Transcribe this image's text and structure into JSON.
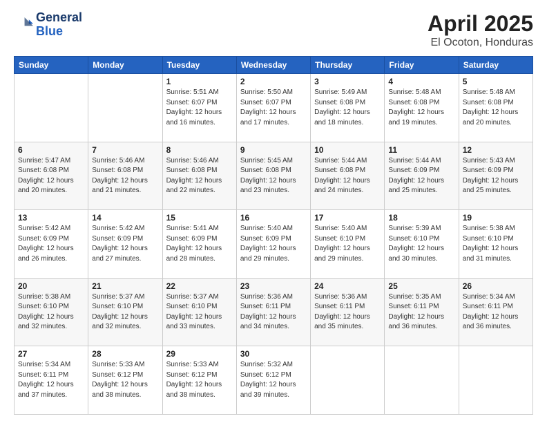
{
  "header": {
    "logo_general": "General",
    "logo_blue": "Blue",
    "title": "April 2025",
    "subtitle": "El Ocoton, Honduras"
  },
  "calendar": {
    "days_of_week": [
      "Sunday",
      "Monday",
      "Tuesday",
      "Wednesday",
      "Thursday",
      "Friday",
      "Saturday"
    ],
    "weeks": [
      [
        {
          "day": "",
          "info": ""
        },
        {
          "day": "",
          "info": ""
        },
        {
          "day": "1",
          "info": "Sunrise: 5:51 AM\nSunset: 6:07 PM\nDaylight: 12 hours and 16 minutes."
        },
        {
          "day": "2",
          "info": "Sunrise: 5:50 AM\nSunset: 6:07 PM\nDaylight: 12 hours and 17 minutes."
        },
        {
          "day": "3",
          "info": "Sunrise: 5:49 AM\nSunset: 6:08 PM\nDaylight: 12 hours and 18 minutes."
        },
        {
          "day": "4",
          "info": "Sunrise: 5:48 AM\nSunset: 6:08 PM\nDaylight: 12 hours and 19 minutes."
        },
        {
          "day": "5",
          "info": "Sunrise: 5:48 AM\nSunset: 6:08 PM\nDaylight: 12 hours and 20 minutes."
        }
      ],
      [
        {
          "day": "6",
          "info": "Sunrise: 5:47 AM\nSunset: 6:08 PM\nDaylight: 12 hours and 20 minutes."
        },
        {
          "day": "7",
          "info": "Sunrise: 5:46 AM\nSunset: 6:08 PM\nDaylight: 12 hours and 21 minutes."
        },
        {
          "day": "8",
          "info": "Sunrise: 5:46 AM\nSunset: 6:08 PM\nDaylight: 12 hours and 22 minutes."
        },
        {
          "day": "9",
          "info": "Sunrise: 5:45 AM\nSunset: 6:08 PM\nDaylight: 12 hours and 23 minutes."
        },
        {
          "day": "10",
          "info": "Sunrise: 5:44 AM\nSunset: 6:08 PM\nDaylight: 12 hours and 24 minutes."
        },
        {
          "day": "11",
          "info": "Sunrise: 5:44 AM\nSunset: 6:09 PM\nDaylight: 12 hours and 25 minutes."
        },
        {
          "day": "12",
          "info": "Sunrise: 5:43 AM\nSunset: 6:09 PM\nDaylight: 12 hours and 25 minutes."
        }
      ],
      [
        {
          "day": "13",
          "info": "Sunrise: 5:42 AM\nSunset: 6:09 PM\nDaylight: 12 hours and 26 minutes."
        },
        {
          "day": "14",
          "info": "Sunrise: 5:42 AM\nSunset: 6:09 PM\nDaylight: 12 hours and 27 minutes."
        },
        {
          "day": "15",
          "info": "Sunrise: 5:41 AM\nSunset: 6:09 PM\nDaylight: 12 hours and 28 minutes."
        },
        {
          "day": "16",
          "info": "Sunrise: 5:40 AM\nSunset: 6:09 PM\nDaylight: 12 hours and 29 minutes."
        },
        {
          "day": "17",
          "info": "Sunrise: 5:40 AM\nSunset: 6:10 PM\nDaylight: 12 hours and 29 minutes."
        },
        {
          "day": "18",
          "info": "Sunrise: 5:39 AM\nSunset: 6:10 PM\nDaylight: 12 hours and 30 minutes."
        },
        {
          "day": "19",
          "info": "Sunrise: 5:38 AM\nSunset: 6:10 PM\nDaylight: 12 hours and 31 minutes."
        }
      ],
      [
        {
          "day": "20",
          "info": "Sunrise: 5:38 AM\nSunset: 6:10 PM\nDaylight: 12 hours and 32 minutes."
        },
        {
          "day": "21",
          "info": "Sunrise: 5:37 AM\nSunset: 6:10 PM\nDaylight: 12 hours and 32 minutes."
        },
        {
          "day": "22",
          "info": "Sunrise: 5:37 AM\nSunset: 6:10 PM\nDaylight: 12 hours and 33 minutes."
        },
        {
          "day": "23",
          "info": "Sunrise: 5:36 AM\nSunset: 6:11 PM\nDaylight: 12 hours and 34 minutes."
        },
        {
          "day": "24",
          "info": "Sunrise: 5:36 AM\nSunset: 6:11 PM\nDaylight: 12 hours and 35 minutes."
        },
        {
          "day": "25",
          "info": "Sunrise: 5:35 AM\nSunset: 6:11 PM\nDaylight: 12 hours and 36 minutes."
        },
        {
          "day": "26",
          "info": "Sunrise: 5:34 AM\nSunset: 6:11 PM\nDaylight: 12 hours and 36 minutes."
        }
      ],
      [
        {
          "day": "27",
          "info": "Sunrise: 5:34 AM\nSunset: 6:11 PM\nDaylight: 12 hours and 37 minutes."
        },
        {
          "day": "28",
          "info": "Sunrise: 5:33 AM\nSunset: 6:12 PM\nDaylight: 12 hours and 38 minutes."
        },
        {
          "day": "29",
          "info": "Sunrise: 5:33 AM\nSunset: 6:12 PM\nDaylight: 12 hours and 38 minutes."
        },
        {
          "day": "30",
          "info": "Sunrise: 5:32 AM\nSunset: 6:12 PM\nDaylight: 12 hours and 39 minutes."
        },
        {
          "day": "",
          "info": ""
        },
        {
          "day": "",
          "info": ""
        },
        {
          "day": "",
          "info": ""
        }
      ]
    ]
  }
}
